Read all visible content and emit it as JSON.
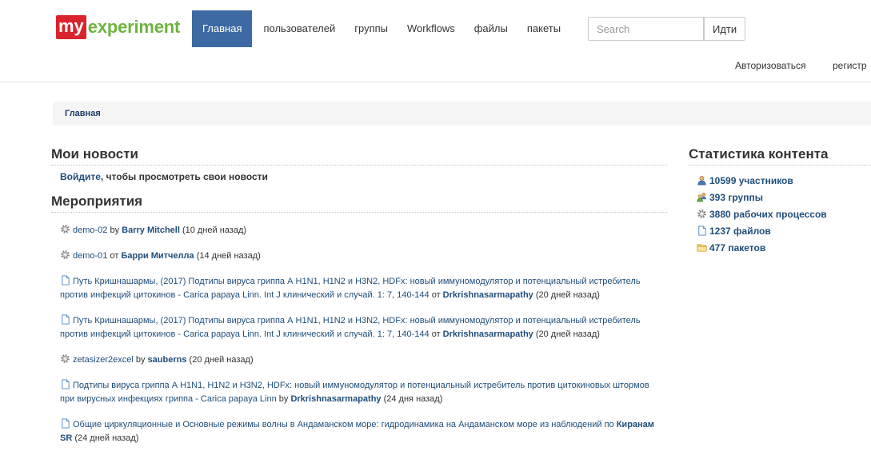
{
  "header": {
    "logo_my": "my",
    "logo_rest": "experiment",
    "nav": [
      "Главная",
      "пользователей",
      "группы",
      "Workflows",
      "файлы",
      "пакеты"
    ],
    "search_placeholder": "Search",
    "go_label": "Идти",
    "login": "Авторизоваться",
    "register": "регистр"
  },
  "breadcrumb": "Главная",
  "news": {
    "title": "Мои новости",
    "login_link": "Войдите",
    "login_rest": ", чтобы просмотреть свои новости"
  },
  "events": {
    "title": "Мероприятия",
    "items": [
      {
        "icon": "gear-icon",
        "text": "demo-02",
        "conn": " by ",
        "user": "Barry Mitchell",
        "ago": " (10 дней назад)"
      },
      {
        "icon": "gear-icon",
        "text": "demo-01",
        "conn": " от ",
        "user": "Барри Митчелла",
        "ago": " (14 дней назад)"
      },
      {
        "icon": "file-icon",
        "text": "Путь Кришнашармы, (2017) Подтипы вируса гриппа А H1N1, H1N2 и H3N2, HDFx: новый иммуномодулятор и потенциальный истребитель против инфекций цитокинов - Carica papaya Linn. Int J клинический и случай. 1: 7, 140-144",
        "conn": " от ",
        "user": "Drkrishnasarmapathy",
        "ago": " (20 дней назад)"
      },
      {
        "icon": "file-icon",
        "text": "Путь Кришнашармы, (2017) Подтипы вируса гриппа А H1N1, H1N2 и H3N2, HDFx: новый иммуномодулятор и потенциальный истребитель против инфекций цитокинов - Carica papaya Linn. Int J клинический и случай. 1: 7, 140-144",
        "conn": " от ",
        "user": "Drkrishnasarmapathy",
        "ago": " (20 дней назад)"
      },
      {
        "icon": "gear-icon",
        "text": "zetasizer2excel",
        "conn": " by ",
        "user": "sauberns",
        "ago": " (20 дней назад)"
      },
      {
        "icon": "file-icon",
        "text": "Подтипы вируса гриппа А H1N1, H1N2 и H3N2, HDFx: новый иммуномодулятор и потенциальный истребитель против цитокиновых штормов при вирусных инфекциях гриппа - Carica papaya Linn",
        "conn": " by ",
        "user": "Drkrishnasarmapathy",
        "ago": " (24 дня назад)"
      },
      {
        "icon": "file-icon",
        "text": "Общие циркуляционные и Основные режимы волны в Андаманском море: гидродинамика на Андаманском море из наблюдений по",
        "conn": " ",
        "user": "Киранам SR",
        "ago": " (24 дней назад)"
      }
    ]
  },
  "stats": {
    "title": "Статистика контента",
    "items": [
      {
        "icon": "user-icon",
        "label": "10599 участников"
      },
      {
        "icon": "group-icon",
        "label": "393 группы"
      },
      {
        "icon": "gear-icon",
        "label": "3880 рабочих процессов"
      },
      {
        "icon": "file-icon",
        "label": "1237 файлов"
      },
      {
        "icon": "folder-icon",
        "label": "477 пакетов"
      }
    ]
  },
  "colors": {
    "accent": "#3d6aa3",
    "link": "#1f4e79",
    "logo_red": "#d9232d",
    "logo_green": "#6db33f"
  }
}
